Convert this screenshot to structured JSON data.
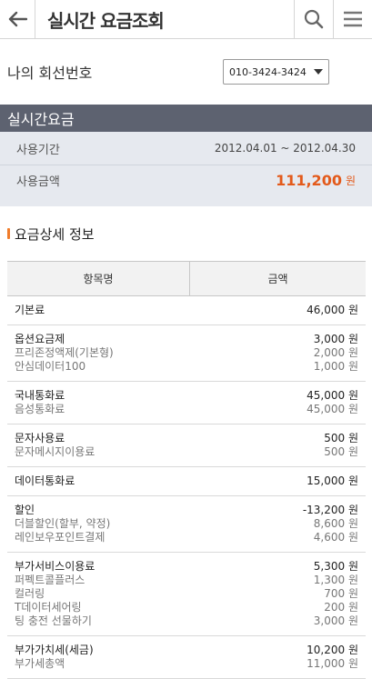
{
  "appbar": {
    "title": "실시간 요금조회"
  },
  "line": {
    "label": "나의 회선번호",
    "selected": "010-3424-3424"
  },
  "realtime": {
    "header": "실시간요금",
    "period_label": "사용기간",
    "period_value": "2012.04.01 ~ 2012.04.30",
    "amount_label": "사용금액",
    "amount_value": "111,200",
    "amount_unit": "원"
  },
  "detail": {
    "title": "요금상세 정보",
    "col_item": "항목명",
    "col_amount": "금액",
    "groups": [
      {
        "lines": [
          [
            "기본료",
            "46,000 원"
          ]
        ]
      },
      {
        "lines": [
          [
            "옵션요금제",
            "3,000 원"
          ],
          [
            "프리존정액제(기본형)",
            "2,000 원"
          ],
          [
            "안심데이터100",
            "1,000 원"
          ]
        ]
      },
      {
        "lines": [
          [
            "국내통화료",
            "45,000 원"
          ],
          [
            "음성통화료",
            "45,000 원"
          ]
        ]
      },
      {
        "lines": [
          [
            "문자사용료",
            "500 원"
          ],
          [
            "문자메시지이용료",
            "500 원"
          ]
        ]
      },
      {
        "lines": [
          [
            "데이터통화료",
            "15,000 원"
          ]
        ]
      },
      {
        "lines": [
          [
            "할인",
            "-13,200 원"
          ],
          [
            "더블할인(할부, 약정)",
            "8,600 원"
          ],
          [
            "레인보우포인트결제",
            "4,600 원"
          ]
        ]
      },
      {
        "lines": [
          [
            "부가서비스이용료",
            "5,300 원"
          ],
          [
            "퍼펙트콜플러스",
            "1,300 원"
          ],
          [
            "컬러링",
            "700 원"
          ],
          [
            "T데이터세어링",
            "200 원"
          ],
          [
            "팅 충전 선물하기",
            "3,000 원"
          ]
        ]
      },
      {
        "lines": [
          [
            "부가가치세(세금)",
            "10,200 원"
          ],
          [
            "부가세총액",
            "11,000 원"
          ]
        ]
      }
    ]
  }
}
